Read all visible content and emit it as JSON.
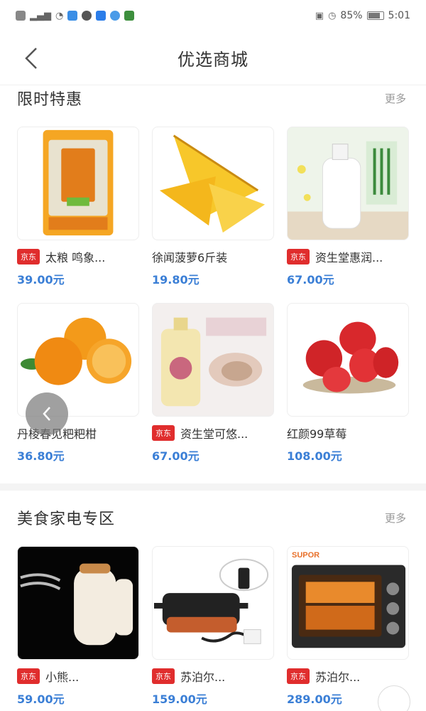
{
  "status_bar": {
    "battery": "85%",
    "time": "5:01"
  },
  "header": {
    "title": "优选商城",
    "back_icon": "chevron-left-icon"
  },
  "section_limited": {
    "title": "限时特惠",
    "more": "更多",
    "products": [
      {
        "tag": "京东",
        "name": "太粮 鸣象...",
        "price": "39.00元",
        "image": "rice-bag"
      },
      {
        "tag": "",
        "name": "徐闻菠萝6斤装",
        "price": "19.80元",
        "image": "pineapple"
      },
      {
        "tag": "京东",
        "name": "资生堂惠润...",
        "price": "67.00元",
        "image": "shampoo-bottle"
      },
      {
        "tag": "",
        "name": "丹棱春见粑粑柑",
        "price": "36.80元",
        "image": "oranges"
      },
      {
        "tag": "京东",
        "name": "资生堂可悠...",
        "price": "67.00元",
        "image": "lotion-bottle"
      },
      {
        "tag": "",
        "name": "红颜99草莓",
        "price": "108.00元",
        "image": "strawberries"
      }
    ]
  },
  "section_food": {
    "title": "美食家电专区",
    "more": "更多",
    "products": [
      {
        "tag": "京东",
        "name": "小熊...",
        "price": "59.00元",
        "image": "hand-mixer"
      },
      {
        "tag": "京东",
        "name": "苏泊尔...",
        "price": "159.00元",
        "image": "electric-pan"
      },
      {
        "tag": "京东",
        "name": "苏泊尔...",
        "price": "289.00元",
        "image": "oven",
        "brand": "SUPOR"
      }
    ]
  },
  "floating_button_icon": "chevron-left-icon"
}
